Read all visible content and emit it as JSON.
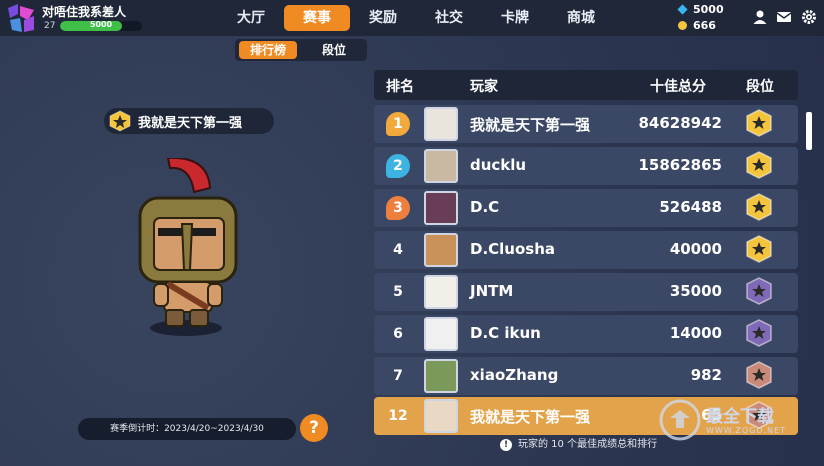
{
  "player": {
    "name": "对唔住我系差人",
    "level": "27",
    "xp_text": "5000",
    "xp_fraction": 0.75
  },
  "nav": {
    "items": [
      "大厅",
      "赛事",
      "奖励",
      "社交",
      "卡牌",
      "商城"
    ],
    "active": "赛事"
  },
  "currency": {
    "gems": "5000",
    "coins": "666"
  },
  "subtabs": {
    "items": [
      "排行榜",
      "段位"
    ],
    "active": "排行榜"
  },
  "profile": {
    "display_name": "我就是天下第一强"
  },
  "season": {
    "countdown": "赛季倒计时：2023/4/20~2023/4/30",
    "help_label": "?"
  },
  "leaderboard": {
    "headers": {
      "rank": "排名",
      "player": "玩家",
      "score": "十佳总分",
      "tier": "段位"
    },
    "rows": [
      {
        "rank": "1",
        "name": "我就是天下第一强",
        "score": "84628942",
        "tier": "gold"
      },
      {
        "rank": "2",
        "name": "ducklu",
        "score": "15862865",
        "tier": "gold"
      },
      {
        "rank": "3",
        "name": "D.C",
        "score": "526488",
        "tier": "gold"
      },
      {
        "rank": "4",
        "name": "D.Cluosha",
        "score": "40000",
        "tier": "gold"
      },
      {
        "rank": "5",
        "name": "JNTM",
        "score": "35000",
        "tier": "purple"
      },
      {
        "rank": "6",
        "name": "D.C ikun",
        "score": "14000",
        "tier": "purple"
      },
      {
        "rank": "7",
        "name": "xiaoZhang",
        "score": "982",
        "tier": "bronze"
      }
    ],
    "self_row": {
      "rank": "12",
      "name": "我就是天下第一强",
      "score": "65",
      "tier": "bronze"
    },
    "footnote": "玩家的 10 个最佳成绩总和排行"
  },
  "watermark": {
    "text": "最全下载",
    "url": "WWW.ZQGD.NET"
  },
  "colors": {
    "accent": "#f08a23",
    "panel": "#1e2638",
    "row": "#3b4865",
    "self_row": "#e3a34a"
  }
}
